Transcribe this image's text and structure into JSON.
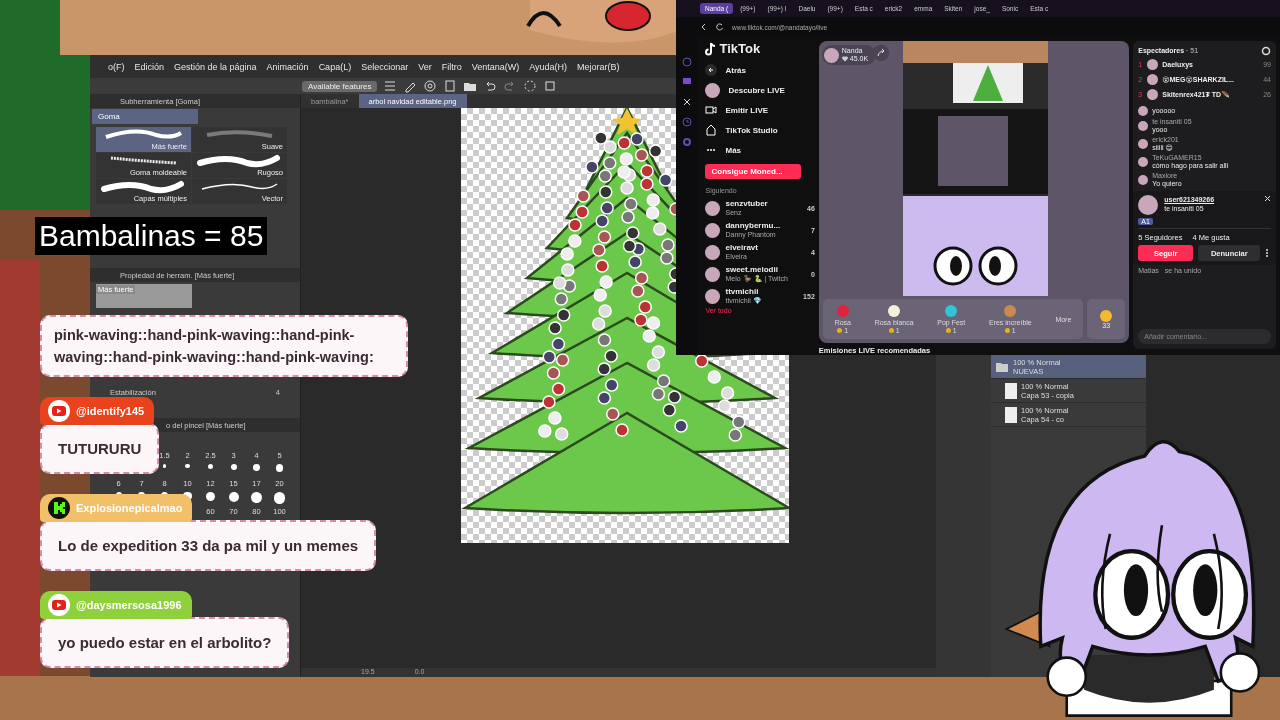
{
  "counter": {
    "text": "Bambalinas = 85"
  },
  "editor": {
    "menu": [
      "o(F)",
      "Edición",
      "Gestión de la página",
      "Animación",
      "Capa(L)",
      "Seleccionar",
      "Ver",
      "Filtro",
      "Ventana(W)",
      "Ayuda(H)",
      "Mejorar(B)"
    ],
    "notice": "Available features",
    "doc_tabs": [
      {
        "label": "bambalina*",
        "selected": false
      },
      {
        "label": "arbol navidad editable.png",
        "selected": true
      }
    ],
    "subtool": {
      "title": "Subherramienta [Goma]",
      "group": "Goma",
      "brushes": [
        {
          "label": "Más fuerte",
          "selected": true,
          "kind": "hard"
        },
        {
          "label": "Suave",
          "selected": false,
          "kind": "soft"
        },
        {
          "label": "Goma moldeable",
          "selected": false,
          "kind": "textured"
        },
        {
          "label": "Rugoso",
          "selected": false,
          "kind": "thick"
        },
        {
          "label": "Capas múltiples",
          "selected": false,
          "kind": "thick"
        },
        {
          "label": "Vector",
          "selected": false,
          "kind": "thin"
        }
      ]
    },
    "tool_property": {
      "title": "Propiedad de herram. [Más fuerte]",
      "preview_label": "Más fuerte",
      "stabilization_label": "Estabilización",
      "stabilization_value": "4"
    },
    "brush_size": {
      "title": "o del pincel [Más fuerte]",
      "rows": [
        [
          "",
          "",
          "1.5",
          "2",
          "2.5",
          "3",
          "4",
          "5"
        ],
        [
          "6",
          "7",
          "8",
          "10",
          "12",
          "15",
          "17",
          "20"
        ],
        [
          "",
          "",
          "",
          "",
          "60",
          "70",
          "80",
          "100"
        ]
      ]
    },
    "status": {
      "zoom": "19.5",
      "angle": "0.0"
    },
    "layers": [
      {
        "mode": "100 % Normal",
        "name": "NUEVAS",
        "kind": "folder",
        "selected": true
      },
      {
        "mode": "100 % Normal",
        "name": "Capa 53 - copia",
        "kind": "layer",
        "selected": false
      },
      {
        "mode": "100 % Normal",
        "name": "Capa 54 - co",
        "kind": "layer",
        "selected": false
      }
    ]
  },
  "browser": {
    "tabs": [
      {
        "label": "Nanda (",
        "selected": true
      },
      {
        "label": "(99+)",
        "selected": false
      },
      {
        "label": "(99+) I",
        "selected": false
      },
      {
        "label": "Daelu",
        "selected": false
      },
      {
        "label": "(99+)",
        "selected": false
      },
      {
        "label": "Esta c",
        "selected": false
      },
      {
        "label": "erick2",
        "selected": false
      },
      {
        "label": "emma",
        "selected": false
      },
      {
        "label": "Skiten",
        "selected": false
      },
      {
        "label": "jose_",
        "selected": false
      },
      {
        "label": "Sonic",
        "selected": false
      },
      {
        "label": "Esta c",
        "selected": false
      }
    ],
    "url": "www.tiktok.com/@nandatayo/live"
  },
  "tiktok": {
    "logo": "TikTok",
    "nav": [
      {
        "label": "Atrás",
        "kind": "back"
      },
      {
        "label": "Descubre LIVE",
        "kind": "avatar"
      },
      {
        "label": "Emitir LIVE",
        "kind": "camera"
      },
      {
        "label": "TikTok Studio",
        "kind": "studio"
      },
      {
        "label": "Más",
        "kind": "more"
      }
    ],
    "coins_button": "Consigue Moned...",
    "following_title": "Siguiendo",
    "following": [
      {
        "name": "senzvtuber",
        "sub": "Senz",
        "count": "46"
      },
      {
        "name": "dannybermu...",
        "sub": "Danny Phantom",
        "count": "7"
      },
      {
        "name": "elveiravt",
        "sub": "Elveira",
        "count": "4"
      },
      {
        "name": "sweet.melodii",
        "sub": "Melo 🦆 🐍 | Twitch",
        "count": "0"
      },
      {
        "name": "ttvmichii",
        "sub": "ttvmichii 💎",
        "count": "152"
      }
    ],
    "see_all": "Ver todo",
    "host": {
      "name": "Nanda",
      "likes": "45.0K"
    },
    "gifts": [
      {
        "name": "Rosa",
        "price": "1",
        "color": "#e0213f"
      },
      {
        "name": "Rosa blanca",
        "price": "1",
        "color": "#f2f2dc"
      },
      {
        "name": "Pop Fest",
        "price": "1",
        "color": "#2fc4d8"
      },
      {
        "name": "Eres increíble",
        "price": "1",
        "color": "#c98a4e"
      }
    ],
    "more": "More",
    "coins": "33",
    "recommended": "Emisiones LIVE recomendadas",
    "viewers_title": "Espectadores",
    "viewers_count": "· 51",
    "top_viewers": [
      {
        "rank": "1",
        "name": "Daeluxys",
        "score": "99"
      },
      {
        "rank": "2",
        "name": "😵MEG😵SHARKZIL...",
        "score": "44"
      },
      {
        "rank": "3",
        "name": "Skitenrex421₮ TD🪶",
        "score": "26"
      }
    ],
    "comments": [
      {
        "text": "yooooo"
      },
      {
        "user": "te insaniti 05",
        "text": "yooo"
      },
      {
        "user": "erick201",
        "text": "siiiii 😊"
      },
      {
        "user": "TeKuGAMER15",
        "text": "cómo hago para salir allí"
      },
      {
        "user": "Maxiore",
        "text": "Yo quiero"
      }
    ],
    "profile": {
      "user": "user621349266",
      "nick": "te insaniti 05",
      "badge": "A1",
      "followers": "5",
      "followers_label": "Seguidores",
      "likes": "4",
      "likes_label": "Me gusta",
      "follow": "Seguir",
      "report": "Denunciar"
    },
    "join": {
      "user": "Matias",
      "text": "se ha unido"
    },
    "comment_placeholder": "Añadir comentario..."
  },
  "chat": [
    {
      "kind": "continued",
      "text": "pink-waving::hand-pink-waving::hand-pink-waving::hand-pink-waving::hand-pink-waving:"
    },
    {
      "kind": "youtube",
      "user": "@identify145",
      "color": "#e8431c",
      "text": "TUTURURU"
    },
    {
      "kind": "kick",
      "user": "Explosionepicalmao",
      "color": "#f3c06a",
      "text": "Lo de expedition 33 da pa mil y un memes"
    },
    {
      "kind": "youtube",
      "user": "@daysmersosa1996",
      "color": "#8fd13c",
      "text": "yo puedo estar en el arbolito?"
    }
  ]
}
